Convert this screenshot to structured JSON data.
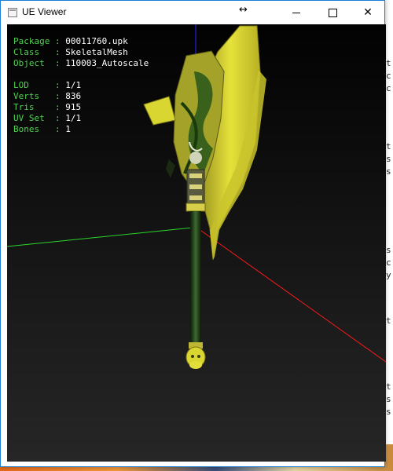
{
  "window": {
    "title": "UE Viewer",
    "controls": {
      "minimize": "minimize",
      "maximize": "maximize",
      "close": "close"
    }
  },
  "info_panel": {
    "asset": [
      {
        "key": "Package",
        "sep": " : ",
        "value": "00011760.upk"
      },
      {
        "key": "Class  ",
        "sep": " : ",
        "value": "SkeletalMesh"
      },
      {
        "key": "Object ",
        "sep": " : ",
        "value": "110003_Autoscale"
      }
    ],
    "stats": [
      {
        "key": "LOD    ",
        "sep": " : ",
        "value": "1/1"
      },
      {
        "key": "Verts  ",
        "sep": " : ",
        "value": "836"
      },
      {
        "key": "Tris   ",
        "sep": " : ",
        "value": "915"
      },
      {
        "key": "UV Set ",
        "sep": " : ",
        "value": "1/1"
      },
      {
        "key": "Bones  ",
        "sep": " : ",
        "value": "1"
      }
    ]
  },
  "scene": {
    "axis_colors": {
      "x": "#ff1a1a",
      "y": "#2bd62b",
      "z": "#2a2aff"
    },
    "model_colors": {
      "primary": "#d9d62a",
      "dark": "#1e3a14",
      "accent": "#8fbf2a"
    }
  },
  "colors": {
    "label": "#4fd24f",
    "value": "#ffffff",
    "window_border": "#1a7fd4"
  }
}
